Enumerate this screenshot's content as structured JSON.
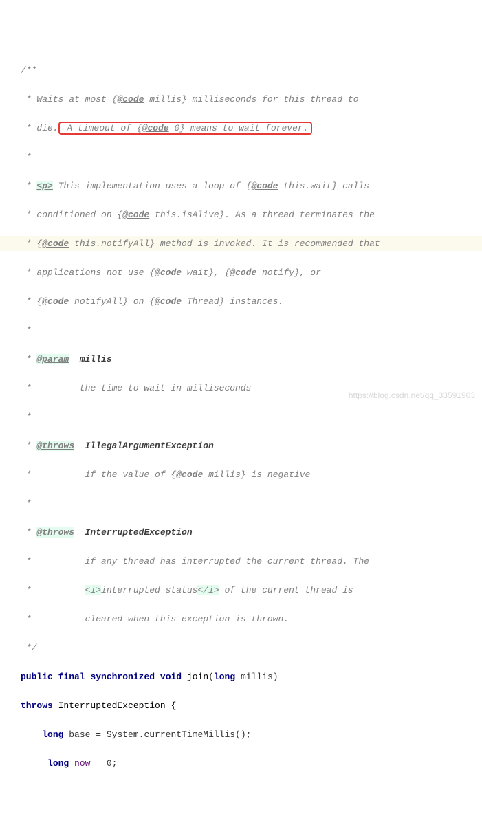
{
  "code": {
    "c1": "/**",
    "c2a": " * Waits at most {",
    "c2_tag": "@code",
    "c2b": " millis} milliseconds for this thread to",
    "c3a": " * die.",
    "c3_box_a": " A timeout of {",
    "c3_box_tag": "@code",
    "c3_box_b": " 0} means to wait forever.",
    "c4": " *",
    "c5a": " * ",
    "c5_p": "<p>",
    "c5b": " This implementation uses a loop of {",
    "c5_tag": "@code",
    "c5c": " this.wait} calls",
    "c6a": " * conditioned on {",
    "c6_tag": "@code",
    "c6b": " this.isAlive}. As a thread terminates the",
    "c7a": " * {",
    "c7_tag": "@code",
    "c7b": " this.notifyAll} method is invoked. It is recommended that",
    "c8a": " * applications not use {",
    "c8_tag1": "@code",
    "c8b": " wait}, {",
    "c8_tag2": "@code",
    "c8c": " notify}, or",
    "c9a": " * {",
    "c9_tag1": "@code",
    "c9b": " notifyAll} on {",
    "c9_tag2": "@code",
    "c9c": " Thread} instances.",
    "c10": " *",
    "c11a": " * ",
    "c11_tag": "@param",
    "c11b": "  ",
    "c11_name": "millis",
    "c12": " *         the time to wait in milliseconds",
    "c13": " *",
    "c14a": " * ",
    "c14_tag": "@throws",
    "c14b": "  ",
    "c14_name": "IllegalArgumentException",
    "c15a": " *          if the value of {",
    "c15_tag": "@code",
    "c15b": " millis} is negative",
    "c16": " *",
    "c17a": " * ",
    "c17_tag": "@throws",
    "c17b": "  ",
    "c17_name": "InterruptedException",
    "c18": " *          if any thread has interrupted the current thread. The",
    "c19a": " *          ",
    "c19_i1": "<i>",
    "c19b": "interrupted status",
    "c19_i2": "</i>",
    "c19c": " of the current thread is",
    "c20": " *          cleared when this exception is thrown.",
    "c21": " */",
    "sig1_kw1": "public",
    "sig1_kw2": "final",
    "sig1_kw3": "synchronized",
    "sig1_kw4": "void",
    "sig1_method": "join",
    "sig1_paren1": "(",
    "sig1_kw5": "long",
    "sig1_param": " millis",
    "sig1_paren2": ")",
    "sig2_kw": "throws",
    "sig2_type": " InterruptedException {",
    "body1_kw": "long",
    "body1_rest": " base = System.currentTimeMillis();",
    "body2_sp": "     ",
    "body2_kw": "long",
    "body2_var": "now",
    "body2_rest": " = 0;"
  },
  "watermark": "https://blog.csdn.net/qq_33591903"
}
